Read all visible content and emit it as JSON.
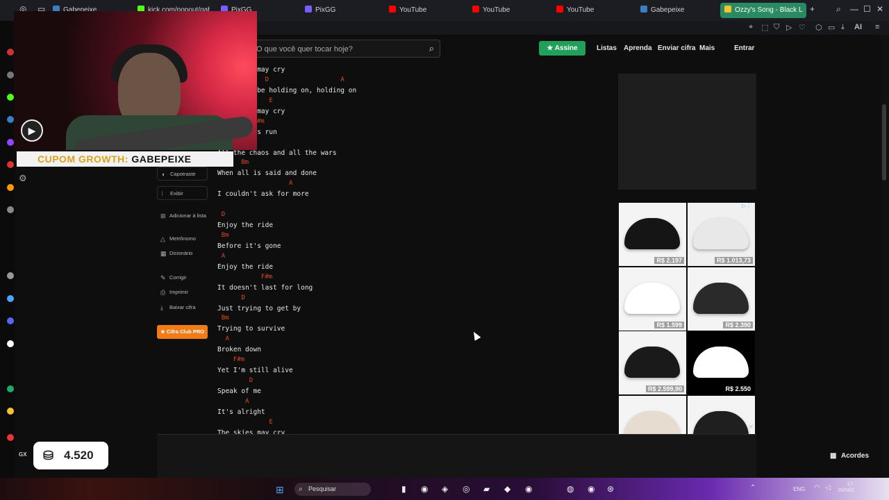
{
  "browser": {
    "tabs": [
      {
        "label": "Gabepeixe",
        "color": "#3b7ec2"
      },
      {
        "label": "kick.com/popout/gabe",
        "color": "#53fc18"
      },
      {
        "label": "PixGG",
        "color": "#7a5cff"
      },
      {
        "label": "PixGG",
        "color": "#7a5cff"
      },
      {
        "label": "YouTube",
        "color": "#ff0000"
      },
      {
        "label": "YouTube",
        "color": "#ff0000"
      },
      {
        "label": "YouTube",
        "color": "#ff0000"
      },
      {
        "label": "Gabepeixe",
        "color": "#3b7ec2"
      },
      {
        "label": "Ozzy's Song - Black L",
        "color": "#f4c430"
      }
    ],
    "new_tab": "+",
    "ai_label": "AI"
  },
  "header": {
    "search_placeholder": "O que você quer tocar hoje?",
    "assine": "Assine",
    "nav": [
      "Listas",
      "Aprenda",
      "Enviar cifra",
      "Mais",
      "Entrar"
    ]
  },
  "overlay": {
    "coupon_prefix": "CUPOM GROWTH:",
    "coupon_code": "GABEPEIXE"
  },
  "side_menu": {
    "capotraste": "Capotraste",
    "exibir": "Exibir",
    "adicionar": "Adicionar à lista",
    "metronomo": "Metrônomo",
    "dicionario": "Dicionário",
    "corrigir": "Corrigir",
    "imprimir": "Imprimir",
    "baixar": "Baixar cifra",
    "pro": "Cifra Club PRO"
  },
  "lyrics": [
    {
      "line": "The skies may cry",
      "chords": []
    },
    {
      "line": "But we'll be holding on, holding on",
      "chords": [
        {
          "c": "D",
          "col": 12
        },
        {
          "c": "A",
          "col": 31
        }
      ]
    },
    {
      "line": "The skies may cry",
      "chords": [
        {
          "c": "E",
          "col": 13
        }
      ]
    },
    {
      "line": "Our race is run",
      "chords": [
        {
          "c": "F#m",
          "col": 9
        }
      ]
    },
    {
      "line": "All the chaos and all the wars",
      "chords": []
    },
    {
      "line": "When all is said and done",
      "chords": [
        {
          "c": "Bm",
          "col": 6
        }
      ]
    },
    {
      "line": "I couldn't ask for more",
      "chords": [
        {
          "c": "A",
          "col": 18
        }
      ]
    },
    {
      "line": "Enjoy the ride",
      "chords": [
        {
          "c": "D",
          "col": 1
        }
      ]
    },
    {
      "line": "Before it's gone",
      "chords": [
        {
          "c": "Bm",
          "col": 1
        }
      ]
    },
    {
      "line": "Enjoy the ride",
      "chords": [
        {
          "c": "A",
          "col": 1
        }
      ]
    },
    {
      "line": "It doesn't last for long",
      "chords": [
        {
          "c": "F#m",
          "col": 11
        }
      ]
    },
    {
      "line": "Just trying to get by",
      "chords": [
        {
          "c": "D",
          "col": 6
        }
      ]
    },
    {
      "line": "Trying to survive",
      "chords": [
        {
          "c": "Bm",
          "col": 1
        }
      ]
    },
    {
      "line": "Broken down",
      "chords": [
        {
          "c": "A",
          "col": 2
        }
      ]
    },
    {
      "line": "Yet I'm still alive",
      "chords": [
        {
          "c": "F#m",
          "col": 4
        }
      ]
    },
    {
      "line": "Speak of me",
      "chords": [
        {
          "c": "D",
          "col": 8
        }
      ]
    },
    {
      "line": "It's alright",
      "chords": [
        {
          "c": "A",
          "col": 7
        }
      ]
    },
    {
      "line": "The skies may cry",
      "chords": [
        {
          "c": "E",
          "col": 13
        }
      ]
    }
  ],
  "ads": {
    "products": [
      {
        "price": "R$ 2.197",
        "shoe": "#151515",
        "bg": "#f4f4f4"
      },
      {
        "price": "R$ 1.013,73",
        "shoe": "#e8e8e8",
        "bg": "#f0f0f0"
      },
      {
        "price": "R$ 1.599",
        "shoe": "#ffffff",
        "bg": "#f4f4f4"
      },
      {
        "price": "R$ 2.390",
        "shoe": "#2a2a2a",
        "bg": "#f4f4f4"
      },
      {
        "price": "R$ 2.599,90",
        "shoe": "#1a1a1a",
        "bg": "#f4f4f4"
      },
      {
        "price": "R$ 2.550",
        "shoe": "#ffffff",
        "bg": "#000000"
      },
      {
        "price": "",
        "shoe": "#e6ddd0",
        "bg": "#f4f4f4"
      },
      {
        "price": "",
        "shoe": "#1f1f1f",
        "bg": "#f4f4f4"
      }
    ]
  },
  "bottom": {
    "acordes": "Acordes",
    "counter": "4.520",
    "gx": "GX"
  },
  "taskbar": {
    "search": "Pesquisar",
    "lang": "ENG",
    "time": "17:",
    "date": "26/04/2"
  },
  "colors": {
    "accent": "#22a05b",
    "chord": "#e2481f",
    "pro": "#f07b17"
  }
}
